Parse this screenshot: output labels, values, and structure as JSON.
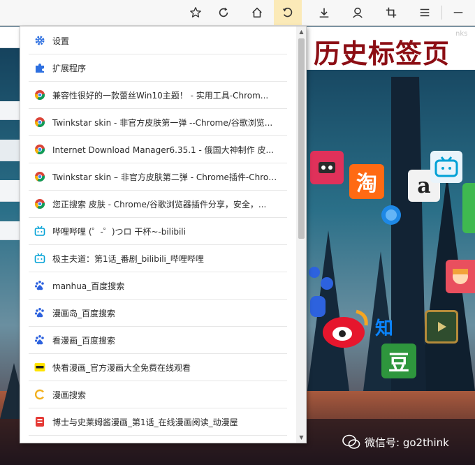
{
  "toolbar": {
    "buttons": [
      {
        "name": "star-button",
        "icon": "star-icon"
      },
      {
        "name": "refresh-button",
        "icon": "refresh-icon"
      },
      {
        "name": "home-button",
        "icon": "home-icon"
      },
      {
        "name": "history-button",
        "icon": "history-icon",
        "active": true
      },
      {
        "name": "download-button",
        "icon": "download-icon"
      },
      {
        "name": "account-button",
        "icon": "user-icon"
      },
      {
        "name": "crop-button",
        "icon": "crop-icon"
      },
      {
        "name": "menu-button",
        "icon": "hamburger-icon"
      },
      {
        "name": "minimize-button",
        "icon": "minimize-icon"
      }
    ],
    "active_color": "#fbeab8"
  },
  "header": {
    "title": "历史标签页",
    "ghost_text": "nks",
    "title_color": "#8c0e14"
  },
  "menu": {
    "items": [
      {
        "label": "设置",
        "icon": "gear-icon"
      },
      {
        "label": "扩展程序",
        "icon": "puzzle-icon"
      },
      {
        "label": "兼容性很好的一款蕾丝Win10主题！ - 实用工具-Chrom...",
        "icon": "chrome-icon"
      },
      {
        "label": "Twinkstar skin - 非官方皮肤第一弹 --Chrome/谷歌浏览...",
        "icon": "chrome-icon"
      },
      {
        "label": "Internet Download Manager6.35.1 - 俄国大神制作 皮...",
        "icon": "chrome-icon"
      },
      {
        "label": "Twinkstar skin – 非官方皮肤第二弹 - Chrome插件-Chrom...",
        "icon": "chrome-icon"
      },
      {
        "label": "您正搜索 皮肤 - Chrome/谷歌浏览器插件分享，安全，...",
        "icon": "chrome-icon"
      },
      {
        "label": "哔哩哔哩 (゜-゜)つロ 干杯~-bilibili",
        "icon": "bilibili-icon"
      },
      {
        "label": "极主夫道：第1话_番剧_bilibili_哔哩哔哩",
        "icon": "bilibili-icon"
      },
      {
        "label": "manhua_百度搜索",
        "icon": "baidu-icon"
      },
      {
        "label": "漫画岛_百度搜索",
        "icon": "baidu-icon"
      },
      {
        "label": "看漫画_百度搜索",
        "icon": "baidu-icon"
      },
      {
        "label": "快看漫画_官方漫画大全免费在线观看",
        "icon": "kuaikan-icon"
      },
      {
        "label": "漫画搜索",
        "icon": "search-c-icon"
      },
      {
        "label": "博士与史莱姆酱漫画_第1话_在线漫画阅读_动漫屋",
        "icon": "dmzj-icon"
      }
    ]
  },
  "apps": {
    "taobao": "淘",
    "amazon": "a",
    "zhihu": "知",
    "douban": "豆"
  },
  "watermark": {
    "text": "微信号: go2think"
  }
}
